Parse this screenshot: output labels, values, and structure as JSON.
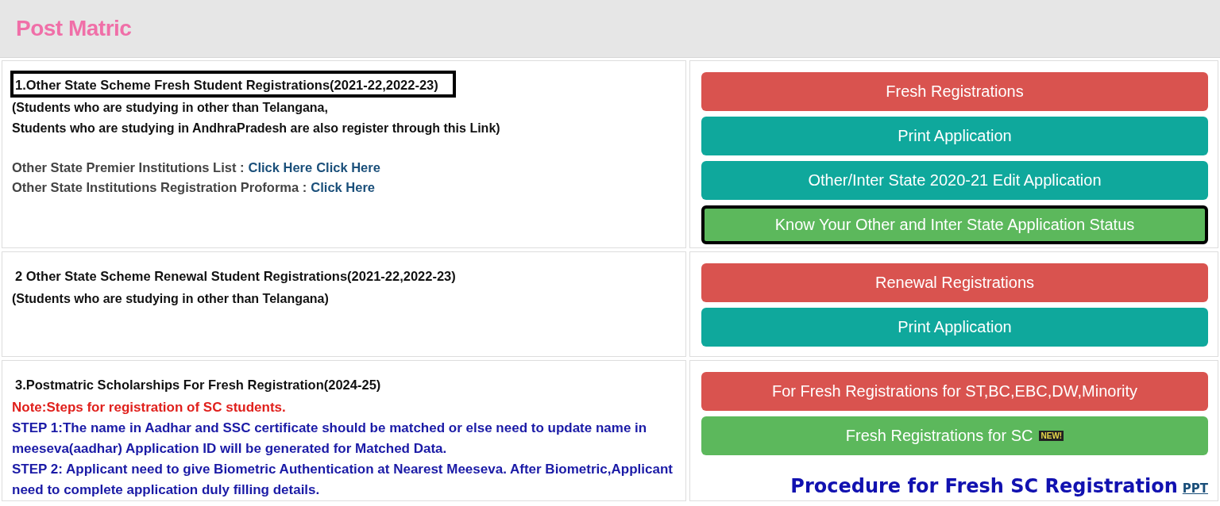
{
  "header": {
    "title": "Post Matric"
  },
  "sections": [
    {
      "heading": "1.Other State Scheme Fresh Student Registrations(2021-22,2022-23)",
      "highlighted": true,
      "lines": [
        {
          "kind": "plain",
          "text": "(Students who are studying in other than Telangana,"
        },
        {
          "kind": "plain",
          "text": "Students who are studying in AndhraPradesh are also register through this Link)"
        },
        {
          "kind": "links",
          "label": "Other State Premier Institutions List :",
          "links": [
            "Click Here",
            "Click Here"
          ]
        },
        {
          "kind": "links",
          "label": "Other State Institutions Registration Proforma :",
          "links": [
            "Click Here"
          ]
        }
      ],
      "buttons": [
        {
          "label": "Fresh Registrations",
          "kind": "red",
          "highlighted": false
        },
        {
          "label": "Print Application",
          "kind": "teal",
          "highlighted": false
        },
        {
          "label": "Other/Inter State 2020-21 Edit Application",
          "kind": "teal",
          "highlighted": false
        },
        {
          "label": "Know Your Other and Inter State Application Status",
          "kind": "green",
          "highlighted": true
        }
      ]
    },
    {
      "heading": "2 Other State Scheme Renewal Student Registrations(2021-22,2022-23)",
      "highlighted": false,
      "lines": [
        {
          "kind": "plain",
          "text": "(Students who are studying in other than Telangana)"
        }
      ],
      "buttons": [
        {
          "label": "Renewal Registrations",
          "kind": "red",
          "highlighted": false
        },
        {
          "label": "Print Application",
          "kind": "teal",
          "highlighted": false
        }
      ]
    },
    {
      "heading": "3.Postmatric Scholarships For Fresh Registration(2024-25)",
      "highlighted": false,
      "lines": [
        {
          "kind": "red",
          "text": "Note:Steps for registration of SC students."
        },
        {
          "kind": "blue",
          "text": "STEP 1:The name in Aadhar and SSC certificate should be matched or else need to update name in meeseva(aadhar) Application ID will be generated for Matched Data."
        },
        {
          "kind": "blue",
          "text": "STEP 2: Applicant need to give Biometric Authentication at Nearest Meeseva. After Biometric,Applicant need to complete application duly filling details."
        }
      ],
      "buttons": [
        {
          "label": "For Fresh Registrations for ST,BC,EBC,DW,Minority",
          "kind": "red",
          "highlighted": false
        },
        {
          "label": "Fresh Registrations for SC",
          "kind": "green",
          "highlighted": false,
          "badge": "NEW!"
        }
      ],
      "procedure": {
        "text": "Procedure for Fresh SC Registration",
        "link": "PPT"
      }
    }
  ]
}
